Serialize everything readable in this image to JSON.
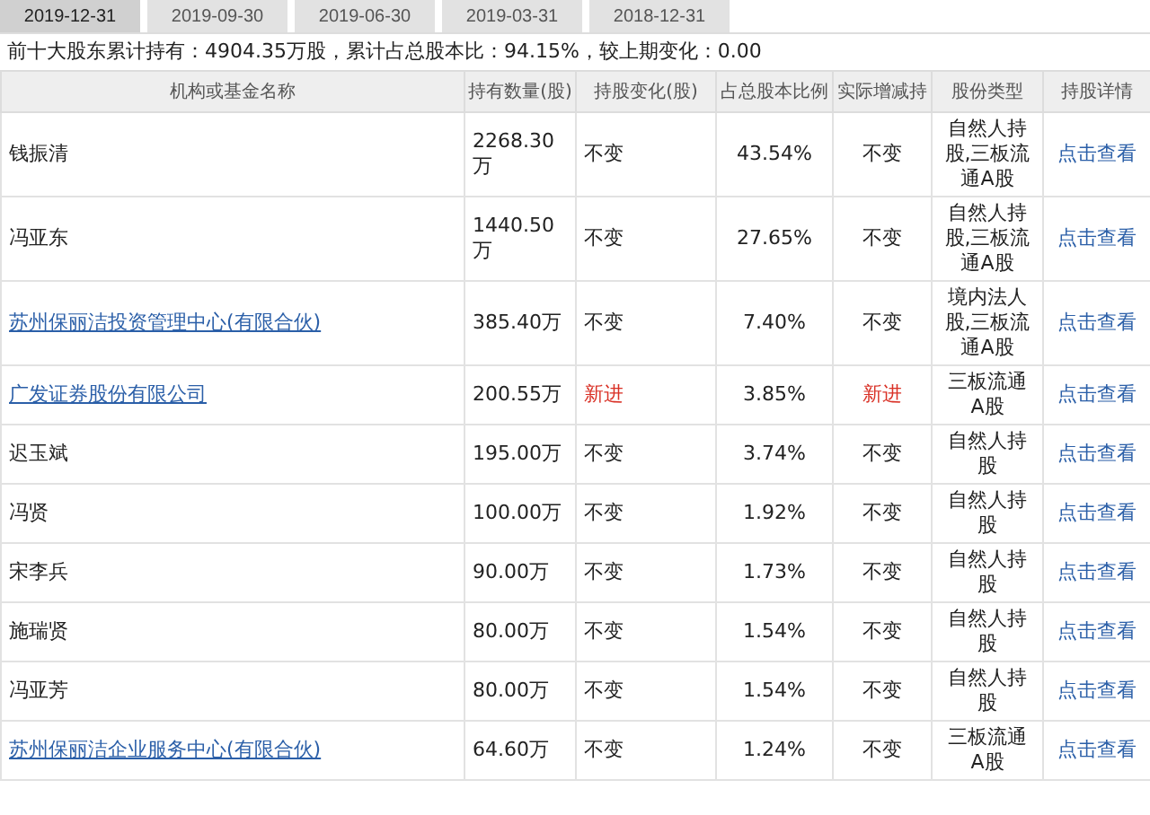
{
  "tabs": [
    {
      "label": "2019-12-31",
      "selected": true
    },
    {
      "label": "2019-09-30",
      "selected": false
    },
    {
      "label": "2019-06-30",
      "selected": false
    },
    {
      "label": "2019-03-31",
      "selected": false
    },
    {
      "label": "2018-12-31",
      "selected": false
    }
  ],
  "summary": "前十大股东累计持有：4904.35万股，累计占总股本比：94.15%，较上期变化：0.00",
  "table": {
    "columns": [
      "机构或基金名称",
      "持有数量(股)",
      "持股变化(股)",
      "占总股本比例",
      "实际增减持",
      "股份类型",
      "持股详情"
    ],
    "rows": [
      {
        "name": "钱振清",
        "name_link": false,
        "quantity": "2268.30万",
        "change": "不变",
        "ratio": "43.54%",
        "actual": "不变",
        "is_new": false,
        "type": "自然人持股,三板流通A股",
        "detail": "点击查看"
      },
      {
        "name": "冯亚东",
        "name_link": false,
        "quantity": "1440.50万",
        "change": "不变",
        "ratio": "27.65%",
        "actual": "不变",
        "is_new": false,
        "type": "自然人持股,三板流通A股",
        "detail": "点击查看"
      },
      {
        "name": "苏州保丽洁投资管理中心(有限合伙)",
        "name_link": true,
        "quantity": "385.40万",
        "change": "不变",
        "ratio": "7.40%",
        "actual": "不变",
        "is_new": false,
        "type": "境内法人股,三板流通A股",
        "detail": "点击查看"
      },
      {
        "name": "广发证券股份有限公司",
        "name_link": true,
        "quantity": "200.55万",
        "change": "新进",
        "ratio": "3.85%",
        "actual": "新进",
        "is_new": true,
        "type": "三板流通A股",
        "detail": "点击查看"
      },
      {
        "name": "迟玉斌",
        "name_link": false,
        "quantity": "195.00万",
        "change": "不变",
        "ratio": "3.74%",
        "actual": "不变",
        "is_new": false,
        "type": "自然人持股",
        "detail": "点击查看"
      },
      {
        "name": "冯贤",
        "name_link": false,
        "quantity": "100.00万",
        "change": "不变",
        "ratio": "1.92%",
        "actual": "不变",
        "is_new": false,
        "type": "自然人持股",
        "detail": "点击查看"
      },
      {
        "name": "宋李兵",
        "name_link": false,
        "quantity": "90.00万",
        "change": "不变",
        "ratio": "1.73%",
        "actual": "不变",
        "is_new": false,
        "type": "自然人持股",
        "detail": "点击查看"
      },
      {
        "name": "施瑞贤",
        "name_link": false,
        "quantity": "80.00万",
        "change": "不变",
        "ratio": "1.54%",
        "actual": "不变",
        "is_new": false,
        "type": "自然人持股",
        "detail": "点击查看"
      },
      {
        "name": "冯亚芳",
        "name_link": false,
        "quantity": "80.00万",
        "change": "不变",
        "ratio": "1.54%",
        "actual": "不变",
        "is_new": false,
        "type": "自然人持股",
        "detail": "点击查看"
      },
      {
        "name": "苏州保丽洁企业服务中心(有限合伙)",
        "name_link": true,
        "quantity": "64.60万",
        "change": "不变",
        "ratio": "1.24%",
        "actual": "不变",
        "is_new": false,
        "type": "三板流通A股",
        "detail": "点击查看"
      }
    ]
  }
}
